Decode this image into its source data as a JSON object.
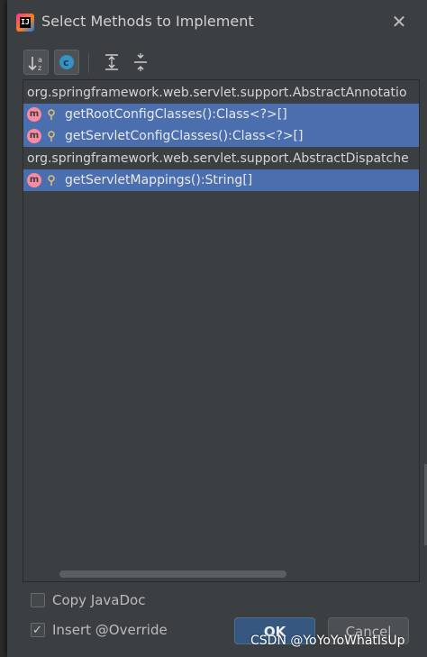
{
  "window": {
    "title": "Select Methods to Implement",
    "app_icon_text": "IJ",
    "close_glyph": "✕"
  },
  "toolbar": {
    "buttons": [
      {
        "icon": "sort-alphabetically-icon"
      },
      {
        "icon": "show-classes-icon"
      },
      {
        "icon": "expand-all-icon"
      },
      {
        "icon": "collapse-all-icon"
      }
    ]
  },
  "tree": {
    "groups": [
      {
        "label": "org.springframework.web.servlet.support.AbstractAnnotatio",
        "methods": [
          {
            "label": "getRootConfigClasses():Class<?>[]"
          },
          {
            "label": "getServletConfigClasses():Class<?>[]"
          }
        ]
      },
      {
        "label": "org.springframework.web.servlet.support.AbstractDispatche",
        "methods": [
          {
            "label": "getServletMappings():String[]"
          }
        ]
      }
    ],
    "method_icon_letter": "m"
  },
  "options": {
    "copy_javadoc": {
      "label": "Copy JavaDoc",
      "checked": false
    },
    "insert_override": {
      "label": "Insert @Override",
      "checked": true
    }
  },
  "buttons": {
    "ok_label": "OK",
    "cancel_label": "Cancel"
  },
  "watermark": "CSDN @YoYoYoWhatIsUp",
  "colors": {
    "background": "#3c3f41",
    "selection": "#4b6eaf",
    "method_icon": "#f98b9e",
    "ok_button": "#365880"
  }
}
